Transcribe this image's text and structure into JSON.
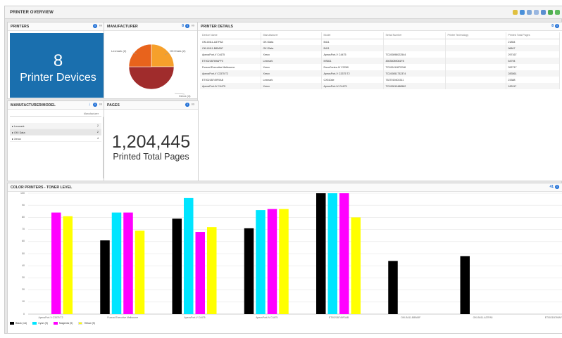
{
  "header": {
    "title": "PRINTER OVERVIEW"
  },
  "printers": {
    "title": "PRINTERS",
    "count": "8",
    "label": "Printer Devices"
  },
  "manufacturer": {
    "title": "MANUFACTURER",
    "badge": "8",
    "slices": [
      {
        "label": "Lexmark (2)",
        "value": 2,
        "color": "#e8631c"
      },
      {
        "label": "OKI Data (2)",
        "value": 2,
        "color": "#f6a02b"
      },
      {
        "label": "Xerox (4)",
        "value": 4,
        "color": "#a02c2c"
      }
    ]
  },
  "details": {
    "title": "PRINTER DETAILS",
    "badge": "8",
    "columns": [
      "Device Name",
      "Manufacturer",
      "Model",
      "Serial Number",
      "Printer Technology",
      "Printed Total Pages"
    ],
    "rows": [
      [
        "OKI-B411-A37FA5",
        "OKI Data",
        "B411",
        "",
        "",
        "21854"
      ],
      [
        "OKI-B411-B85A5F",
        "OKI Data",
        "B411",
        "",
        "",
        "96847"
      ],
      [
        "ApeosPort-V C4475",
        "Xerox",
        "ApeosPort-V C4475",
        "TC100898022544",
        "",
        "297167"
      ],
      [
        "ET0021B769AFF0",
        "Lexmark",
        "MS811",
        "45035089081F8",
        "",
        "64794"
      ],
      [
        "Fussnd Executive Melbourne",
        "Xerox",
        "DocuCentre-IV C2260",
        "TC100411872248",
        "",
        "392717"
      ],
      [
        "ApeosPort-V C3375 T2",
        "Xerox",
        "ApeosPort-V C3375 T2",
        "TC100851732374",
        "",
        "283561"
      ],
      [
        "ET0021B749F0AB",
        "Lexmark",
        "CX510de",
        "7527019401511",
        "",
        "23388"
      ],
      [
        "ApeosPort-IV C4475",
        "Xerox",
        "ApeosPort-IV C4475",
        "TC100810488562",
        "",
        "183117"
      ]
    ]
  },
  "model": {
    "title": "MANUFACTURER/MODEL",
    "col": "Manufacturer",
    "rows": [
      {
        "name": "Lexmark",
        "count": "2"
      },
      {
        "name": "OKI Data",
        "count": "2"
      },
      {
        "name": "Xerox",
        "count": "4"
      }
    ]
  },
  "pages": {
    "title": "PAGES",
    "total": "1,204,445",
    "label": "Printed Total Pages"
  },
  "toner": {
    "title": "COLOR PRINTERS - TONER LEVEL",
    "badge": "41",
    "legend": [
      "Black (14)",
      "Cyan (9)",
      "Magenta (9)",
      "Yellow (9)"
    ]
  },
  "colors": {
    "black": "#000000",
    "cyan": "#00e5ff",
    "magenta": "#ff00ff",
    "yellow": "#ffff00",
    "blue": "#1a6fae"
  },
  "chart_data": {
    "type": "bar",
    "title": "COLOR PRINTERS - TONER LEVEL",
    "ylim": [
      0,
      100
    ],
    "yticks": [
      0,
      10,
      20,
      30,
      40,
      50,
      60,
      70,
      80,
      90,
      100
    ],
    "categories": [
      "ApeosPort-V C3375 T2",
      "Fussnd Executive Melbourne",
      "ApeosPort-V C4475",
      "ApeosPort-IV C4475",
      "ET0021B749F0AB",
      "OKI-B411-B85A5F",
      "OKI-B411-A37FA5",
      "ET0021B769AFF0"
    ],
    "series": [
      {
        "name": "Black (14)",
        "color": "#000000",
        "values": [
          null,
          61,
          79,
          71,
          100,
          44,
          48,
          null
        ]
      },
      {
        "name": "Cyan (9)",
        "color": "#00e5ff",
        "values": [
          null,
          84,
          96,
          86,
          100,
          null,
          null,
          null
        ]
      },
      {
        "name": "Magenta (9)",
        "color": "#ff00ff",
        "values": [
          84,
          84,
          68,
          87,
          100,
          null,
          null,
          null
        ]
      },
      {
        "name": "Yellow (9)",
        "color": "#ffff00",
        "values": [
          81,
          69,
          72,
          87,
          80,
          null,
          null,
          null
        ]
      }
    ]
  }
}
